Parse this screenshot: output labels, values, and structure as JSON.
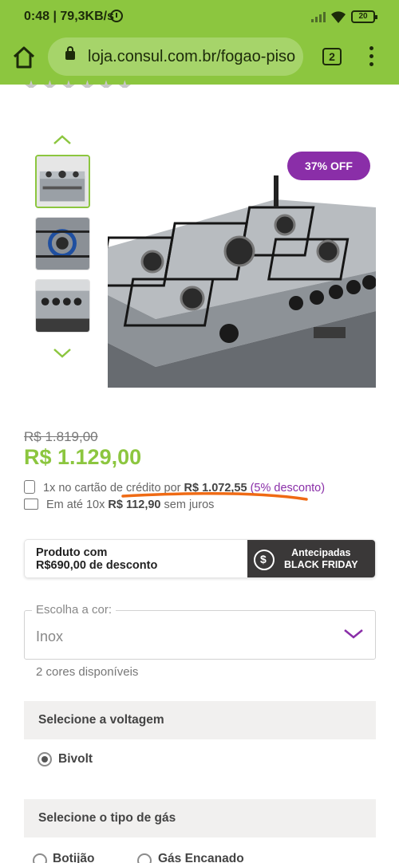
{
  "status_bar": {
    "time_speed": "0:48 | 79,3KB/s",
    "battery": "20"
  },
  "browser": {
    "url": "loja.consul.com.br/fogao-piso",
    "tab_count": "2"
  },
  "product": {
    "discount_badge": "37% OFF",
    "old_price": "R$ 1.819,00",
    "price": "R$ 1.129,00",
    "credit": {
      "prefix": "1x no cartão de crédito por",
      "value": "R$ 1.072,55",
      "discount": "(5% desconto)"
    },
    "installments": {
      "prefix": "Em até 10x",
      "value": "R$ 112,90",
      "suffix": "sem juros"
    }
  },
  "banner": {
    "left_line1": "Produto com",
    "left_line2": "R$690,00 de desconto",
    "right_line1": "Antecipadas",
    "right_line2": "BLACK FRIDAY"
  },
  "color_select": {
    "legend": "Escolha a cor:",
    "value": "Inox",
    "available": "2 cores disponíveis"
  },
  "voltage": {
    "title": "Selecione a voltagem",
    "options": [
      {
        "label": "Bivolt",
        "selected": true
      }
    ]
  },
  "gas": {
    "title": "Selecione o tipo de gás",
    "options": [
      {
        "label": "Botijão",
        "selected": false
      },
      {
        "label": "Gás Encanado",
        "selected": false
      }
    ]
  },
  "colors": {
    "brand_green": "#8cc63f",
    "brand_purple": "#8a2ea8",
    "dark": "#3a3838"
  }
}
